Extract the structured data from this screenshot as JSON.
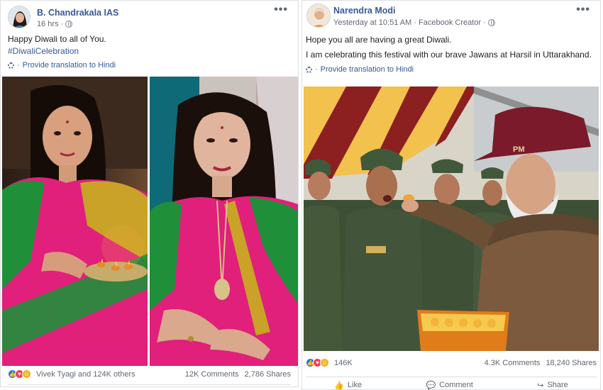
{
  "posts": [
    {
      "author": "B. Chandrakala IAS",
      "time": "16 hrs",
      "lines": [
        "Happy Diwali to all of You."
      ],
      "hashtag": "#DiwaliCelebration",
      "translate": "Provide translation to Hindi",
      "reactors": "Vivek Tyagi and 124K others",
      "comments": "12K Comments",
      "shares": "2,786 Shares"
    },
    {
      "author": "Narendra Modi",
      "time": "Yesterday at 10:51 AM · Facebook Creator",
      "lines": [
        "Hope you all are having a great Diwali.",
        "I am celebrating this festival with our brave Jawans at Harsil in Uttarakhand."
      ],
      "translate": "Provide translation to Hindi",
      "reactors": "146K",
      "comments": "4.3K Comments",
      "shares": "18,240 Shares",
      "actions": [
        "Like",
        "Comment",
        "Share"
      ]
    }
  ],
  "icons": {
    "more": "more-options-icon",
    "privacy": "globe-icon",
    "translate": "gear-icon",
    "reactions": [
      "like-reaction-icon",
      "love-reaction-icon",
      "haha-reaction-icon"
    ]
  },
  "photo_labels": {
    "cap_text": "PM"
  },
  "colors": {
    "link": "#385898",
    "muted": "#606770",
    "saree_pink": "#e0207a",
    "saree_green": "#1f8f3a",
    "tent_red": "#8c1f1f",
    "tent_yellow": "#f2c14e",
    "uniform_green": "#3d4f34",
    "cap_maroon": "#7a1a2a"
  }
}
